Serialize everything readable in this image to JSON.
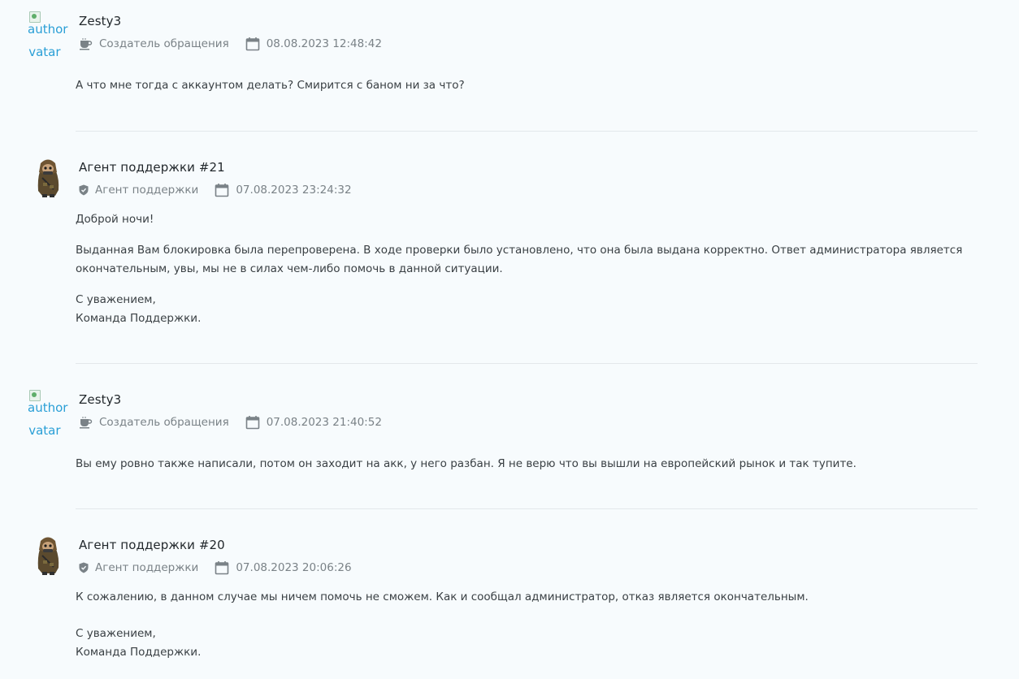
{
  "messages": [
    {
      "author": "Zesty3",
      "role": "Создатель обращения",
      "datetime": "08.08.2023 12:48:42",
      "avatar_alt_1": "author",
      "avatar_alt_2": "avatar",
      "paragraphs": [
        "А что мне тогда с аккаунтом делать? Смирится с баном ни за что?"
      ]
    },
    {
      "author": "Агент поддержки #21",
      "role": "Агент поддержки",
      "datetime": "07.08.2023 23:24:32",
      "paragraphs": [
        "Доброй ночи!",
        "Выданная Вам блокировка была перепроверена. В ходе проверки было установлено, что она была выдана корректно. Ответ администратора является окончательным, увы, мы не в силах чем-либо помочь в данной ситуации.",
        "С уважением,",
        "Команда Поддержки."
      ]
    },
    {
      "author": "Zesty3",
      "role": "Создатель обращения",
      "datetime": "07.08.2023 21:40:52",
      "avatar_alt_1": "author",
      "avatar_alt_2": "avatar",
      "paragraphs": [
        "Вы ему ровно также написали, потом он заходит на акк, у него разбан. Я не верю что вы вышли на европейский рынок и так тупите."
      ]
    },
    {
      "author": "Агент поддержки #20",
      "role": "Агент поддержки",
      "datetime": "07.08.2023 20:06:26",
      "paragraphs": [
        "К сожалению, в данном случае мы ничем помочь не сможем. Как и сообщал администратор, отказ является окончательным.",
        "С уважением,",
        "Команда Поддержки."
      ]
    }
  ],
  "icons": {
    "creator_role": "coffee-cup-icon",
    "agent_role": "shield-icon",
    "date": "calendar-icon"
  },
  "colors": {
    "link_blue": "#2a9fd6",
    "meta_gray": "#7a8287",
    "background": "#f7fbfd"
  }
}
